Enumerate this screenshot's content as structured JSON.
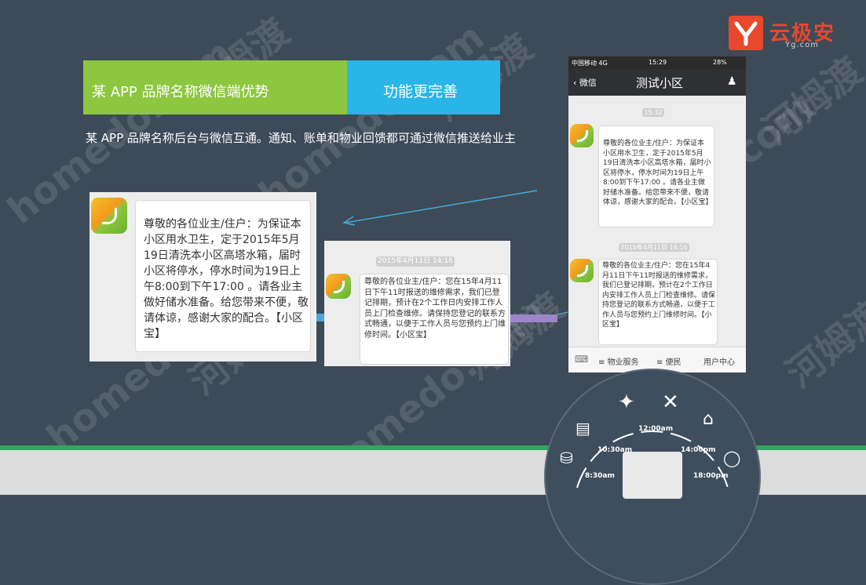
{
  "brand": {
    "name": "云极安",
    "sub": "Yg.com"
  },
  "banner": {
    "left_title": "某 APP 品牌名称微信端优势",
    "right_title": "功能更完善"
  },
  "description": "某 APP 品牌名称后台与微信互通。通知、账单和物业回馈都可通过微信推送给业主",
  "card_large": {
    "message": "尊敬的各位业主/住户：为保证本小区用水卫生，定于2015年5月19日清洗本小区高塔水箱，届时小区将停水，停水时间为19日上午8:00到下午17:00 。请各业主做好储水准备。给您带来不便，敬请体谅，感谢大家的配合。【小区宝】"
  },
  "card_mid": {
    "timestamp": "2015年4月11日 14:16",
    "message": "尊敬的各位业主/住户：您在15年4月11日下午11时报送的维修需求，我们已登记排期，预计在2个工作日内安排工作人员上门检查维修。请保持您登记的联系方式畅通，以便于工作人员与您预约上门维修时间。【小区宝】"
  },
  "phone": {
    "status_carrier": "中国移动  4G",
    "status_time": "15:29",
    "status_battery": "28%",
    "back_label": "微信",
    "title": "测试小区",
    "stamp1": "15:32",
    "message1": "尊敬的各位业主/住户：为保证本小区用水卫生，定于2015年5月19日清洗本小区高塔水箱，届时小区将停水，停水时间为19日上午8:00到下午17:00 。请各业主做好储水准备。给您带来不便，敬请体谅，感谢大家的配合。【小区宝】",
    "stamp2": "2015年4月11日 14:16",
    "message2": "尊敬的各位业主/住户：您在15年4月11日下午11时报送的维修需求，我们已登记排期，预计在2个工作日内安排工作人员上门检查维修。请保持您登记的联系方式畅通，以便于工作人员与您预约上门维修时间。【小区宝】",
    "tabs": [
      "物业服务",
      "便民",
      "用户中心"
    ]
  },
  "clock": {
    "t1": "12:00am",
    "t2": "10:30am",
    "t3": "14:00pm",
    "t4": "8:30am",
    "t5": "18:00pm"
  },
  "watermark": {
    "a": "homedo.com",
    "b": "河姆渡"
  }
}
